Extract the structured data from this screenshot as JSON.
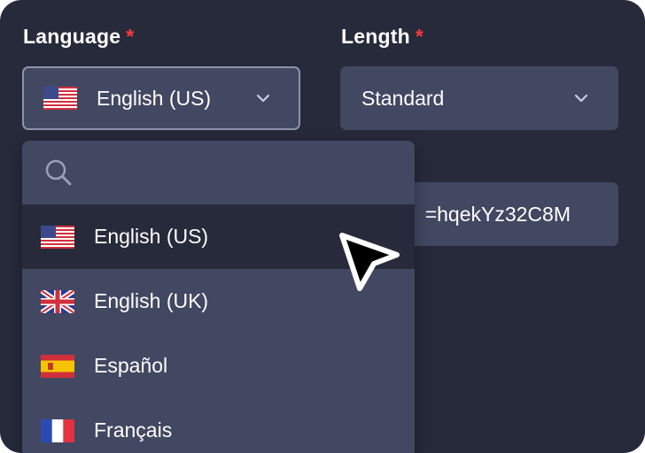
{
  "language": {
    "label": "Language",
    "required_mark": "*",
    "selected": "English (US)"
  },
  "length": {
    "label": "Length",
    "required_mark": "*",
    "selected": "Standard"
  },
  "url_field": {
    "value": "=hqekYz32C8M"
  },
  "dropdown": {
    "search_placeholder": "",
    "options": [
      {
        "label": "English (US)",
        "flag": "us-flag-icon",
        "selected": true
      },
      {
        "label": "English (UK)",
        "flag": "uk-flag-icon",
        "selected": false
      },
      {
        "label": "Español",
        "flag": "es-flag-icon",
        "selected": false
      },
      {
        "label": "Français",
        "flag": "fr-flag-icon",
        "selected": false
      }
    ]
  },
  "colors": {
    "background": "#262a3b",
    "control": "#424862",
    "required": "#ff3b3b",
    "text": "#ffffff"
  }
}
